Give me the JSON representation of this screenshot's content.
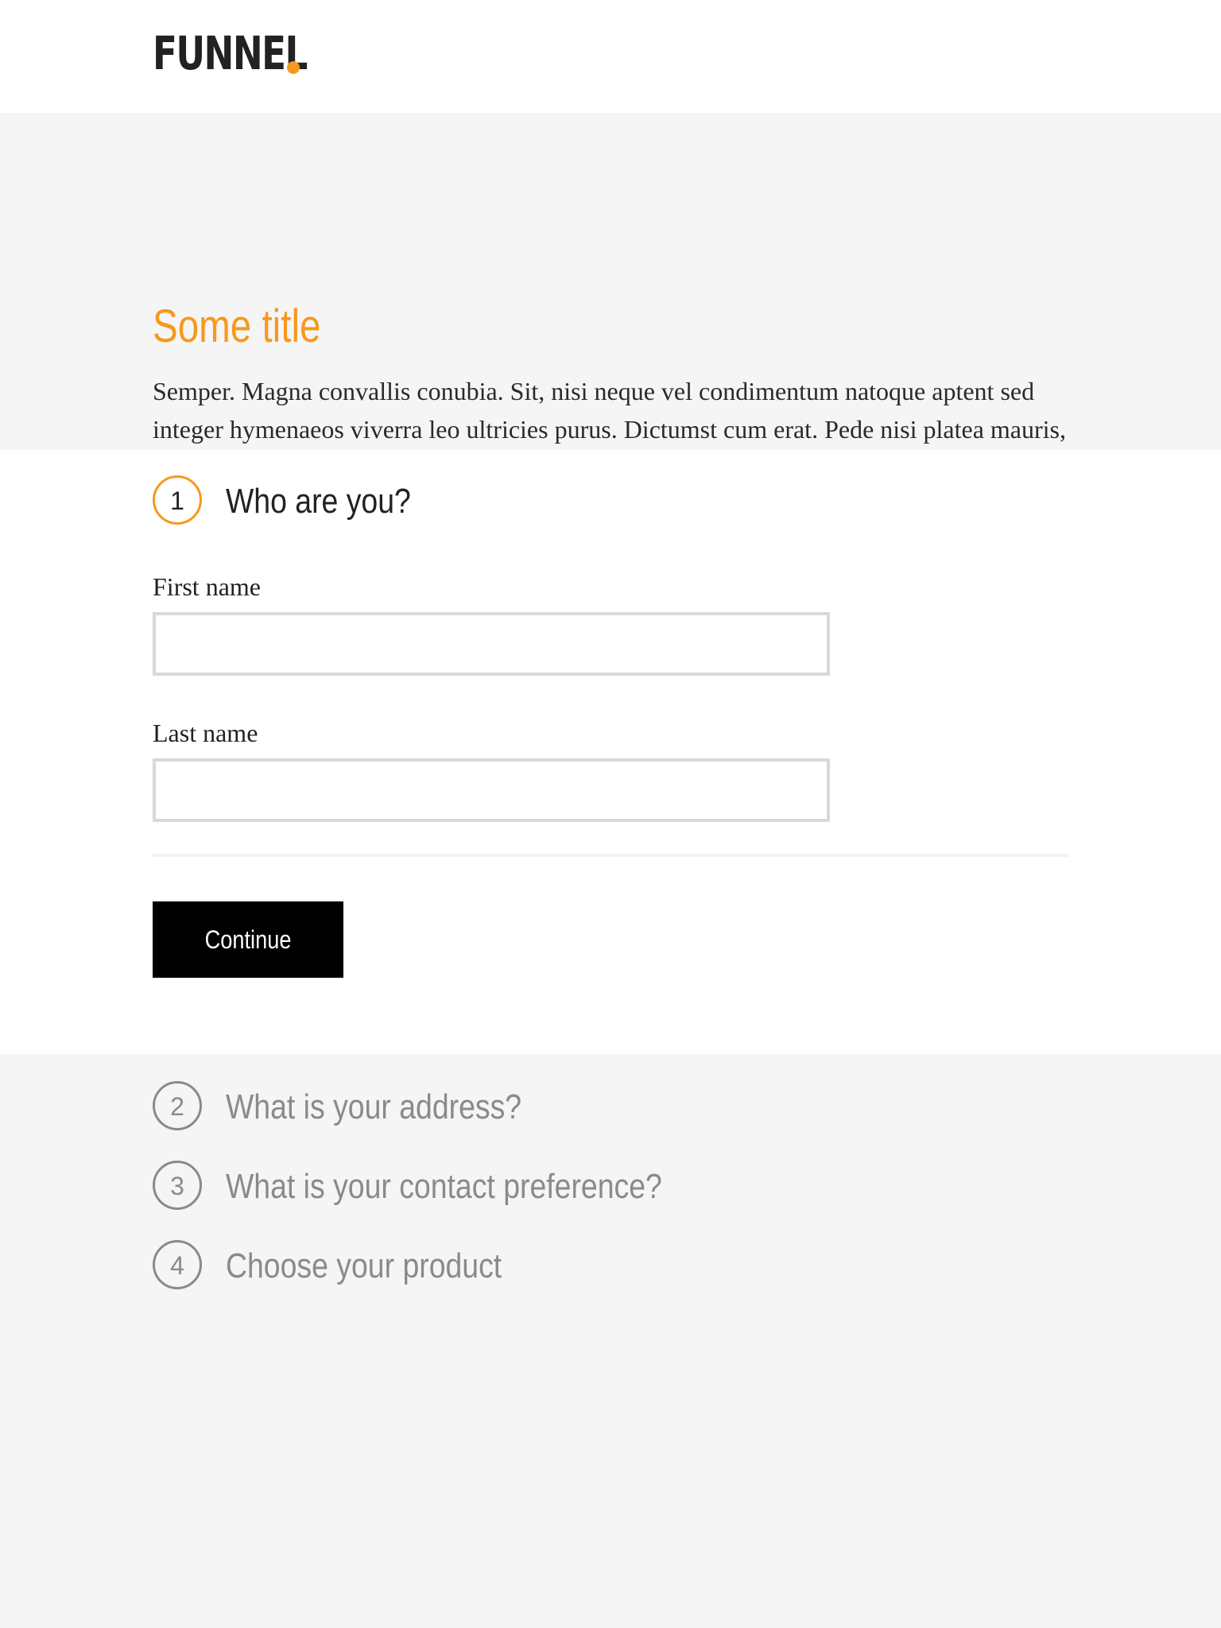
{
  "header": {
    "logo_text": "FUNNEL",
    "accent_color": "#f6991e"
  },
  "hero": {
    "title": "Some title",
    "description": "Semper. Magna convallis conubia. Sit, nisi neque vel condimentum natoque aptent sed integer hymenaeos viverra leo ultricies purus. Dictumst cum erat. Pede nisi platea mauris, litora tortor vestibulum primis cum purus ipsum Rhoncus metus."
  },
  "active_step": {
    "number": "1",
    "title": "Who are you?",
    "fields": [
      {
        "label": "First name",
        "value": "",
        "placeholder": ""
      },
      {
        "label": "Last name",
        "value": "",
        "placeholder": ""
      }
    ],
    "continue_label": "Continue"
  },
  "pending_steps": [
    {
      "number": "2",
      "title": "What is your address?"
    },
    {
      "number": "3",
      "title": "What is your contact preference?"
    },
    {
      "number": "4",
      "title": "Choose your product"
    }
  ]
}
